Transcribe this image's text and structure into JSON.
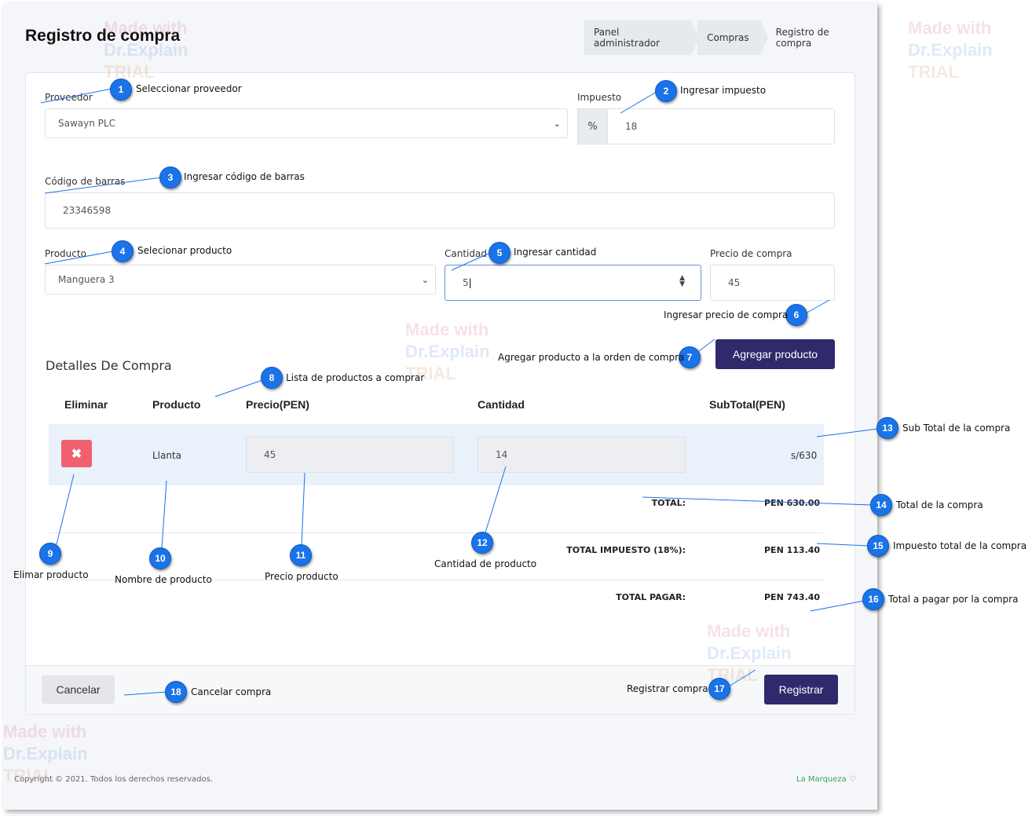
{
  "page": {
    "title": "Registro de compra"
  },
  "breadcrumb": [
    "Panel administrador",
    "Compras",
    "Registro de compra"
  ],
  "form": {
    "proveedor_label": "Proveedor",
    "proveedor_value": "Sawayn PLC",
    "impuesto_label": "Impuesto",
    "impuesto_addon": "%",
    "impuesto_value": "18",
    "barcode_label": "Código de barras",
    "barcode_value": "23346598",
    "producto_label": "Producto",
    "producto_value": "Manguera 3",
    "cantidad_label": "Cantidad",
    "cantidad_value": "5",
    "precio_label": "Precio de compra",
    "precio_value": "45",
    "add_button": "Agregar producto"
  },
  "details": {
    "title": "Detalles De Compra",
    "headers": [
      "Eliminar",
      "Producto",
      "Precio(PEN)",
      "Cantidad",
      "SubTotal(PEN)"
    ],
    "row": {
      "producto": "Llanta",
      "precio": "45",
      "cantidad": "14",
      "subtotal": "s/630"
    },
    "totals": [
      {
        "label": "TOTAL:",
        "value": "PEN 630.00"
      },
      {
        "label": "TOTAL IMPUESTO (18%):",
        "value": "PEN 113.40"
      },
      {
        "label": "TOTAL PAGAR:",
        "value": "PEN 743.40"
      }
    ]
  },
  "footer": {
    "cancel": "Cancelar",
    "submit": "Registrar"
  },
  "page_footer": {
    "copyright": "Copyright © 2021. Todos los derechos reservados.",
    "brand": "La Marqueza"
  },
  "callouts": [
    {
      "n": "1",
      "text": "Seleccionar proveedor"
    },
    {
      "n": "2",
      "text": "Ingresar impuesto"
    },
    {
      "n": "3",
      "text": "Ingresar código de barras"
    },
    {
      "n": "4",
      "text": "Selecionar producto"
    },
    {
      "n": "5",
      "text": "Ingresar cantidad"
    },
    {
      "n": "6",
      "text": "Ingresar precio de compra"
    },
    {
      "n": "7",
      "text": "Agregar producto a la orden de compra"
    },
    {
      "n": "8",
      "text": "Lista de productos a comprar"
    },
    {
      "n": "9",
      "text": "Elimar producto"
    },
    {
      "n": "10",
      "text": "Nombre de producto"
    },
    {
      "n": "11",
      "text": "Precio producto"
    },
    {
      "n": "12",
      "text": "Cantidad de producto"
    },
    {
      "n": "13",
      "text": "Sub Total de la compra"
    },
    {
      "n": "14",
      "text": "Total de la compra"
    },
    {
      "n": "15",
      "text": "Impuesto total de la compra"
    },
    {
      "n": "16",
      "text": "Total a pagar por la compra"
    },
    {
      "n": "17",
      "text": "Registrar compra"
    },
    {
      "n": "18",
      "text": "Cancelar compra"
    }
  ],
  "watermark": {
    "line1": "Made with",
    "line2": "Dr.Explain",
    "line3": "TRIAL"
  },
  "colors": {
    "primary": "#2f2a6b",
    "danger": "#f0606e",
    "callout": "#1a73e8",
    "brand": "#3aa655"
  }
}
